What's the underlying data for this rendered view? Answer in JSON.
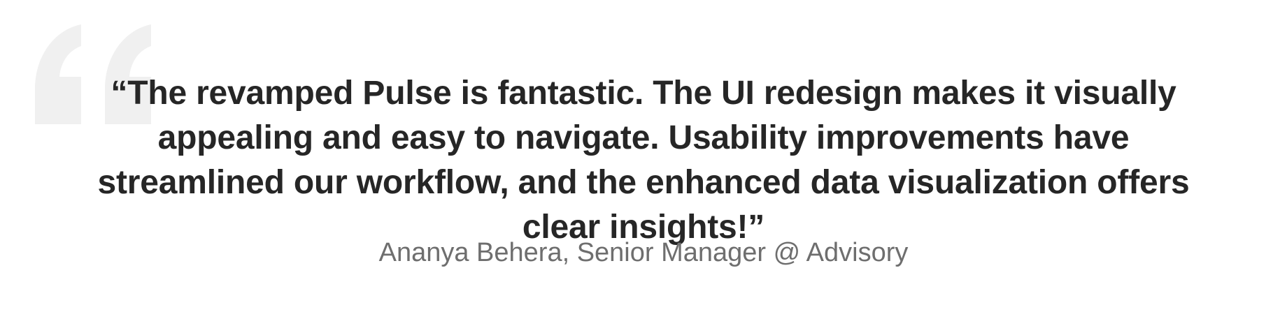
{
  "testimonial": {
    "quote": "“The revamped Pulse is fantastic. The UI redesign makes it visually appealing and easy to navigate. Usability improvements have streamlined our workflow, and the enhanced data visualization offers clear insights!”",
    "attribution": "Ananya Behera, Senior Manager @ Advisory"
  },
  "icons": {
    "decorative_quote": "quote-mark-icon"
  },
  "colors": {
    "quote_text": "#262626",
    "attribution_text": "#6e6e6e",
    "quote_mark": "#f0f0f0",
    "background": "#ffffff"
  }
}
